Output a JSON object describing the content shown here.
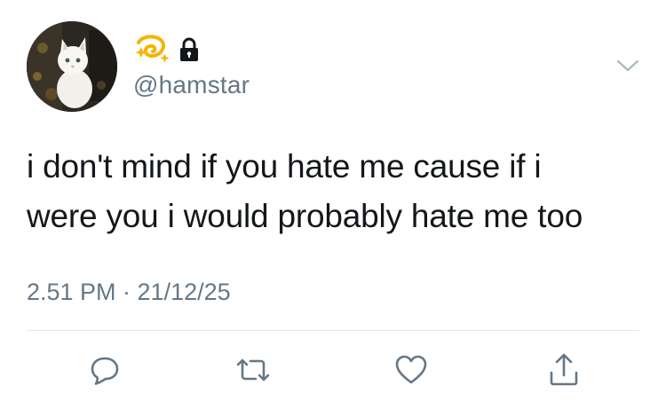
{
  "tweet": {
    "avatar_icon": "cat-photo-avatar",
    "name_emojis": [
      "dizzy-emoji-icon",
      "lock-icon"
    ],
    "handle": "@hamstar",
    "text_lines": [
      "i don't mind if you hate me cause if i",
      "were you i would probably hate me too"
    ],
    "timestamp": "2.51 PM · 21/12/25",
    "menu_icon": "chevron-down-icon"
  },
  "actions": [
    {
      "name": "reply",
      "icon": "reply-icon"
    },
    {
      "name": "retweet",
      "icon": "retweet-icon"
    },
    {
      "name": "like",
      "icon": "heart-icon"
    },
    {
      "name": "share",
      "icon": "share-icon"
    }
  ],
  "colors": {
    "text": "#14171a",
    "secondary": "#657786",
    "divider": "#e1e8ed",
    "emoji_gold": "#f5b400"
  }
}
